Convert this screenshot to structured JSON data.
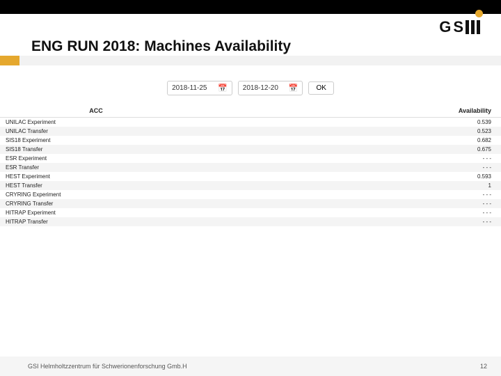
{
  "header": {
    "title": "ENG RUN 2018: Machines Availability",
    "logo_letters": {
      "g": "G",
      "s": "S"
    }
  },
  "controls": {
    "date_from": "2018-11-25",
    "date_to": "2018-12-20",
    "ok_label": "OK"
  },
  "table": {
    "head_acc": "ACC",
    "head_avail": "Availability",
    "rows": [
      {
        "acc": "UNILAC Experiment",
        "avail": "0.539"
      },
      {
        "acc": "UNILAC Transfer",
        "avail": "0.523"
      },
      {
        "acc": "SIS18 Experiment",
        "avail": "0.682"
      },
      {
        "acc": "SIS18 Transfer",
        "avail": "0.675"
      },
      {
        "acc": "ESR Experiment",
        "avail": "- - -"
      },
      {
        "acc": "ESR Transfer",
        "avail": "- - -"
      },
      {
        "acc": "HEST Experiment",
        "avail": "0.593"
      },
      {
        "acc": "HEST Transfer",
        "avail": "1"
      },
      {
        "acc": "CRYRING Experiment",
        "avail": "- - -"
      },
      {
        "acc": "CRYRING Transfer",
        "avail": "- - -"
      },
      {
        "acc": "HITRAP Experiment",
        "avail": "- - -"
      },
      {
        "acc": "HITRAP Transfer",
        "avail": "- - -"
      }
    ]
  },
  "footer": {
    "org": "GSI Helmholtzzentrum für Schwerionenforschung Gmb.H",
    "page": "12"
  }
}
